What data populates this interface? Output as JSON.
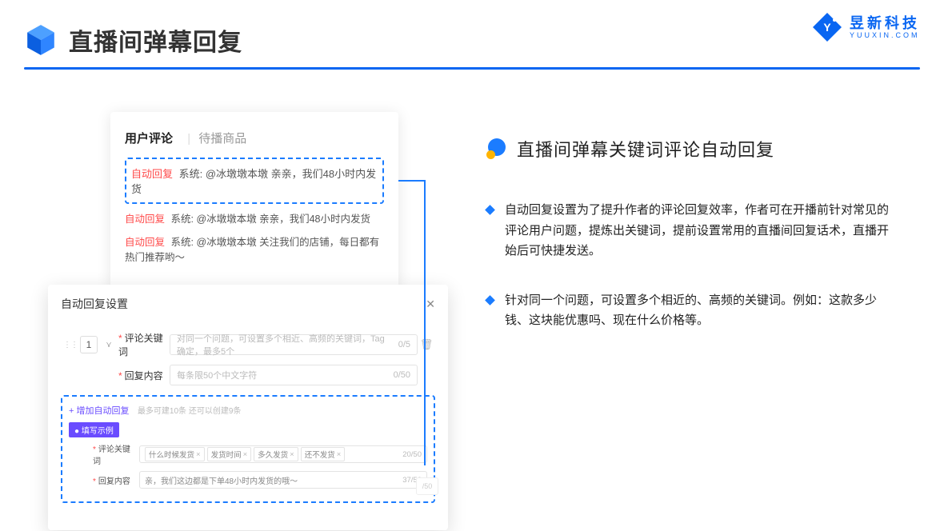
{
  "header": {
    "title": "直播间弹幕回复",
    "brand_name": "昱新科技",
    "brand_url": "YUUXIN.COM"
  },
  "comments": {
    "tab_active": "用户评论",
    "tab_inactive": "待播商品",
    "row_highlight_tag": "自动回复",
    "row_highlight_text": "系统: @冰墩墩本墩 亲亲，我们48小时内发货",
    "row2_tag": "自动回复",
    "row2_text": "系统: @冰墩墩本墩 亲亲，我们48小时内发货",
    "row3_tag": "自动回复",
    "row3_text": "系统: @冰墩墩本墩 关注我们的店铺，每日都有热门推荐哟～"
  },
  "settings": {
    "title": "自动回复设置",
    "num": "1",
    "kw_label": "评论关键词",
    "kw_placeholder": "对同一个问题，可设置多个相近、高频的关键词，Tag确定，最多5个",
    "kw_count": "0/5",
    "content_label": "回复内容",
    "content_placeholder": "每条限50个中文字符",
    "content_count": "0/50",
    "add_link": "+ 增加自动回复",
    "add_hint": "最多可建10条 还可以创建9条",
    "example_badge": "● 填写示例",
    "ex_kw_label": "评论关键词",
    "chips": [
      "什么时候发货",
      "发货时间",
      "多久发货",
      "还不发货"
    ],
    "ex_kw_count": "20/50",
    "ex_content_label": "回复内容",
    "ex_content_text": "亲，我们这边都是下单48小时内发货的哦～",
    "ex_content_count": "37/50",
    "ghost_count": "/50"
  },
  "right": {
    "section_title": "直播间弹幕关键词评论自动回复",
    "bullet1": "自动回复设置为了提升作者的评论回复效率，作者可在开播前针对常见的评论用户问题，提炼出关键词，提前设置常用的直播间回复话术，直播开始后可快捷发送。",
    "bullet2": "针对同一个问题，可设置多个相近的、高频的关键词。例如：这款多少钱、这块能优惠吗、现在什么价格等。"
  }
}
